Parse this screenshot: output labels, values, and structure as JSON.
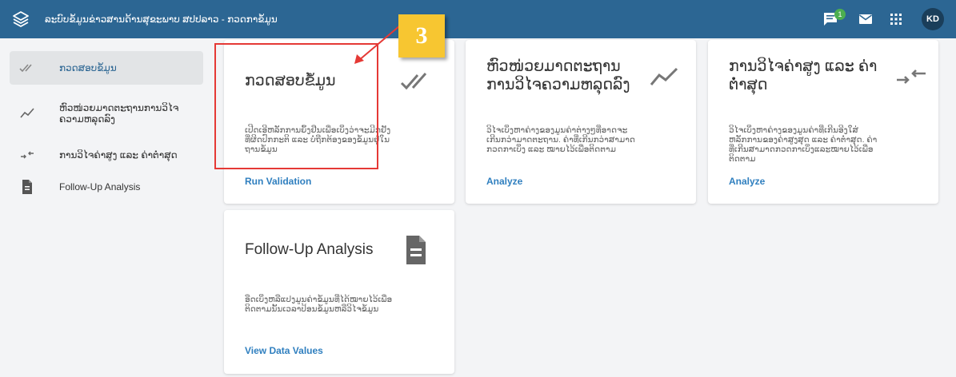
{
  "header": {
    "title": "ລະບົບຂໍ້ມູນຂ່າວສານດ້ານສຸຂະພາບ ສປປລາວ - ກວດກາຂໍ້ມູນ",
    "notification_count": "1",
    "avatar_initials": "KD"
  },
  "sidebar": {
    "items": [
      {
        "label": "ກວດສອບຂໍ້ມູນ",
        "icon": "double-check-icon"
      },
      {
        "label": "ຫົວໜ່ວຍມາດຕະຖານການວິໄຈຄວາມຫລຸດລົງ",
        "icon": "trend-line-icon"
      },
      {
        "label": "ການວິໄຈຄ່າສູງ ແລະ ຄ່າຕໍ່າສຸດ",
        "icon": "compress-arrows-icon"
      },
      {
        "label": "Follow-Up Analysis",
        "icon": "document-icon"
      }
    ]
  },
  "cards": [
    {
      "title": "ກວດສອບຂໍ້ມູນ",
      "description": "ເປີດເອີຫລັກການຍຶ້ງຢືນເພື່ອເບິ່ງວ່າຈະມີກຢັງທີ່ຜິດປົກກະຕິ ແລະ ບໍ່ຖືກຕ້ອງຂອງຂໍ້ມູນຢູ່ໃນຖານຂໍ້ມູນ",
      "action": "Run Validation",
      "icon": "double-check-icon"
    },
    {
      "title": "ຫົວໜ່ວຍມາດຕະຖານການວິໄຈຄວາມຫລຸດລົງ",
      "description": "ວິໄຈເບິ່ງຫາຄ່າງຂອງມູນຄ່າຕ່າງໆທີ່ອາດຈະເກີນກວ່າມາດຕະຖານ. ຄ່າທີ່ເກີນກວ່າສາມາດກວດກາເບິ່ງ ແລະ ໝາຍໄວ້ເພື່ອຕິດຕາມ",
      "action": "Analyze",
      "icon": "trend-line-icon"
    },
    {
      "title": "ການວິໄຈຄ່າສູງ ແລະ ຄ່າຕໍ່າສຸດ",
      "description": "ວິໄຈເບິ່ງຫາຄ່າງຂອງມູນຄ່າທີ່ເກີນອີງໃສ່ຫລັກການຂອງຄ່າສູງສຸດ ແລະ ຄ່າຕໍ່າສຸດ. ຄ່າທີ່ເກີນສາມາດກວດກາເບິ່ງແລະໝາຍໄວ້ເພື່ອຕິດຕາມ",
      "action": "Analyze",
      "icon": "compress-arrows-icon"
    },
    {
      "title": "Follow-Up Analysis",
      "description": "ອືດເບິ່ງຫລືແປງມູນຄ່າຂໍ້ມູນທີ່ໄດ້ໝາຍໄວ້ເພື່ອຕິດຕາມນັ້ນເວລາປ້ອນຂໍ້ມູນຫລືວິໄຈຂໍ້ມູນ",
      "action": "View Data Values",
      "icon": "document-icon"
    }
  ],
  "annotation": {
    "step": "3"
  },
  "colors": {
    "header": "#2c6693",
    "link": "#2f7fbf",
    "highlight": "#e53935",
    "badge": "#f7c631"
  }
}
